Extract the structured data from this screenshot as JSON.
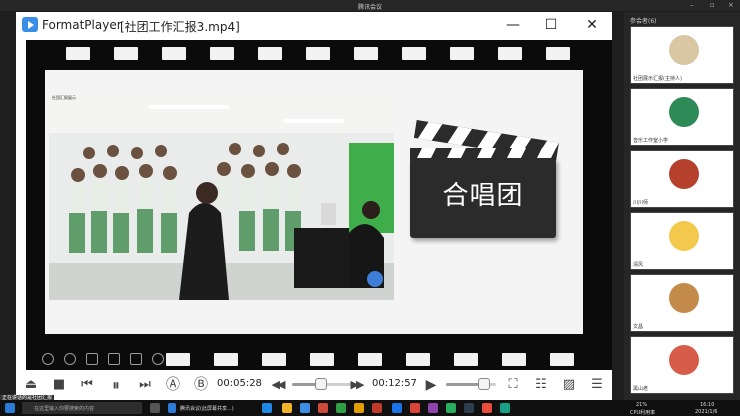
{
  "meeting": {
    "title": "腾讯会议",
    "panel_header": "参会者(6)",
    "participants": [
      {
        "name": "社团展示汇报(主持人)",
        "color": "#d9c7a3"
      },
      {
        "name": "音乐工作室小学",
        "color": "#2e8b57"
      },
      {
        "name": "川川师",
        "color": "#b5412d"
      },
      {
        "name": "清风",
        "color": "#f2c94c"
      },
      {
        "name": "文昌",
        "color": "#c48a4a"
      },
      {
        "name": "黑山老",
        "color": "#d85c4a"
      }
    ]
  },
  "player": {
    "app_name": "FormatPlayer",
    "file_name": "[社团工作汇报3.mp4]",
    "window_buttons": {
      "minimize": "—",
      "maximize": "☐",
      "close": "✕"
    },
    "slide": {
      "photo_caption": "社团汇报展示",
      "clapper_text": "合唱团"
    },
    "controls": {
      "eject": "⏏",
      "stop": "■",
      "prev": "⏮",
      "play_pause": "⏸",
      "next": "⏭",
      "ab_a": "Ⓐ",
      "ab_b": "Ⓑ",
      "current_time": "00:05:28",
      "rewind": "◀◀",
      "forward": "▶▶",
      "total_time": "00:12:57",
      "play": "▶",
      "fullscreen": "⛶",
      "settings": "☷",
      "screenshot": "▨",
      "playlist": "☰",
      "progress": 0.42,
      "volume": 0.75
    }
  },
  "taskbar": {
    "search_placeholder": "在这里输入你要搜索的内容",
    "app_label": "腾讯会议(此屏幕共享...)",
    "tray_text": "21%",
    "tray_sub": "CPU利用率",
    "clock_time": "16:10",
    "clock_date": "2021/1/6",
    "floating_tag": "正在讲话的是社团汇报"
  }
}
